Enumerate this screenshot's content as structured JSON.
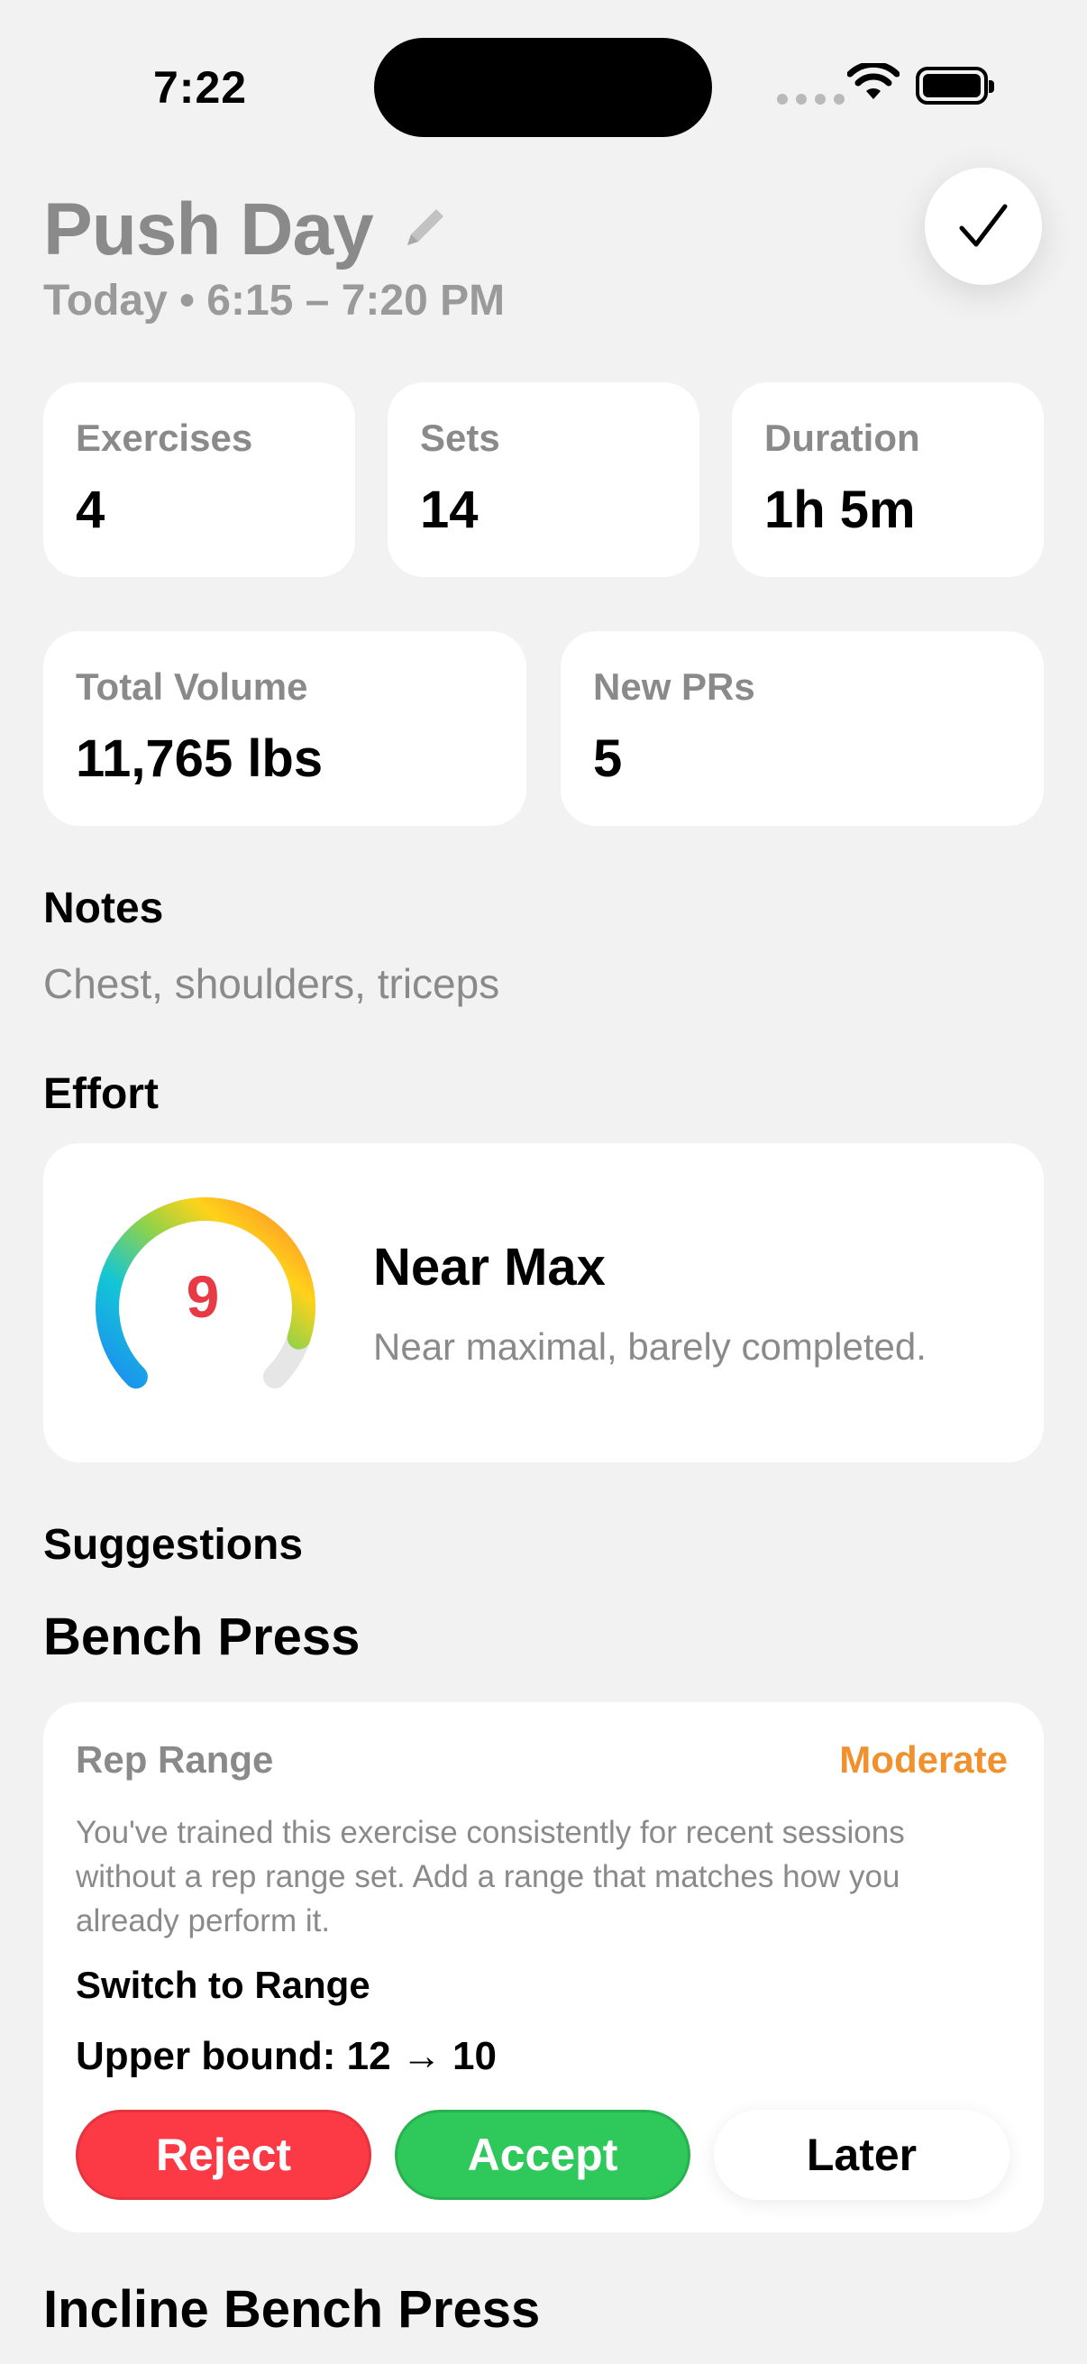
{
  "status_bar": {
    "time": "7:22"
  },
  "workout": {
    "title": "Push Day",
    "subtitle": "Today • 6:15 – 7:20 PM"
  },
  "stats": [
    {
      "label": "Exercises",
      "value": "4"
    },
    {
      "label": "Sets",
      "value": "14"
    },
    {
      "label": "Duration",
      "value": "1h 5m"
    },
    {
      "label": "Total Volume",
      "value": "11,765 lbs"
    },
    {
      "label": "New PRs",
      "value": "5"
    }
  ],
  "notes": {
    "heading": "Notes",
    "text": "Chest, shoulders, triceps"
  },
  "effort": {
    "heading": "Effort",
    "value": "9",
    "value_max": 10,
    "title": "Near Max",
    "description": "Near maximal, barely completed."
  },
  "suggestions": {
    "heading": "Suggestions",
    "exercises": [
      {
        "name": "Bench Press",
        "type": "Rep Range",
        "level": "Moderate",
        "description": "You've trained this exercise consistently for recent sessions without a rep range set. Add a range that matches how you already perform it.",
        "action": "Switch to Range",
        "change": "Upper bound: 12 → 10",
        "buttons": {
          "reject": "Reject",
          "accept": "Accept",
          "later": "Later"
        }
      },
      {
        "name": "Incline Bench Press"
      }
    ]
  },
  "colors": {
    "background": "#f2f2f2",
    "accent_orange": "#f0912e",
    "reject_red": "#fb3a45",
    "accept_green": "#2fc85a",
    "effort_number": "#e83a45"
  },
  "icons": {
    "edit": "pencil-icon",
    "done": "checkmark-icon",
    "wifi": "wifi-icon",
    "battery": "battery-icon"
  }
}
